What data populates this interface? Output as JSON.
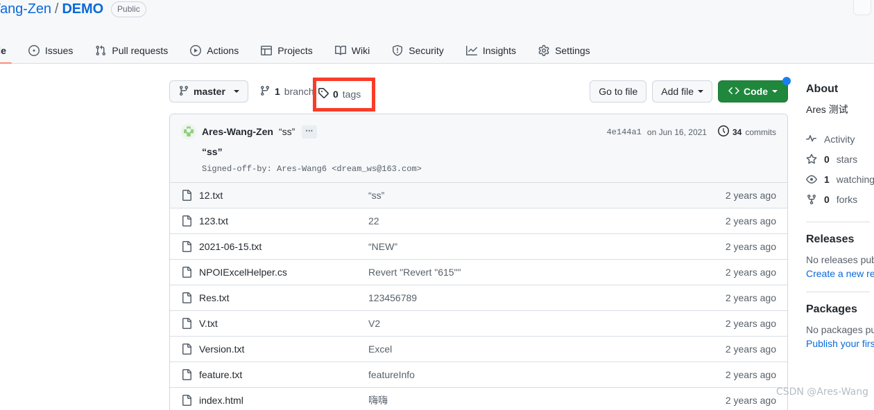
{
  "header": {
    "owner": "res-Wang-Zen",
    "separator": "/",
    "repo": "DEMO",
    "visibility": "Public",
    "nav": [
      {
        "label": "ode",
        "icon": "code-icon",
        "name": "tab-code",
        "selected": true
      },
      {
        "label": "Issues",
        "icon": "issue-opened-icon",
        "name": "tab-issues",
        "selected": false
      },
      {
        "label": "Pull requests",
        "icon": "git-pull-request-icon",
        "name": "tab-pull-requests",
        "selected": false
      },
      {
        "label": "Actions",
        "icon": "play-icon",
        "name": "tab-actions",
        "selected": false
      },
      {
        "label": "Projects",
        "icon": "table-icon",
        "name": "tab-projects",
        "selected": false
      },
      {
        "label": "Wiki",
        "icon": "book-icon",
        "name": "tab-wiki",
        "selected": false
      },
      {
        "label": "Security",
        "icon": "shield-icon",
        "name": "tab-security",
        "selected": false
      },
      {
        "label": "Insights",
        "icon": "graph-icon",
        "name": "tab-insights",
        "selected": false
      },
      {
        "label": "Settings",
        "icon": "gear-icon",
        "name": "tab-settings",
        "selected": false
      }
    ]
  },
  "branch_bar": {
    "branch_button_label": "master",
    "branches_count": "1",
    "branches_label": "branch",
    "tags_count": "0",
    "tags_label": "tags",
    "go_to_file": "Go to file",
    "add_file": "Add file",
    "code": "Code"
  },
  "highlight": {
    "color": "#fa3c28",
    "target": "0 tags"
  },
  "commit": {
    "author": "Ares-Wang-Zen",
    "title_inline": "“ss”",
    "ellipsis": "…",
    "message": "“ss”",
    "signoff": "Signed-off-by: Ares-Wang6 <dream_ws@163.com>",
    "sha": "4e144a1",
    "date": "on Jun 16, 2021",
    "commits_count": "34",
    "commits_label": "commits"
  },
  "files": [
    {
      "name": "12.txt",
      "message": "“ss”",
      "time": "2 years ago",
      "highlight": true
    },
    {
      "name": "123.txt",
      "message": "22",
      "time": "2 years ago",
      "highlight": false
    },
    {
      "name": "2021-06-15.txt",
      "message": "“NEW”",
      "time": "2 years ago",
      "highlight": false
    },
    {
      "name": "NPOIExcelHelper.cs",
      "message": "Revert \"Revert \"615\"\"",
      "time": "2 years ago",
      "highlight": false
    },
    {
      "name": "Res.txt",
      "message": "123456789",
      "time": "2 years ago",
      "highlight": false
    },
    {
      "name": "V.txt",
      "message": "V2",
      "time": "2 years ago",
      "highlight": false
    },
    {
      "name": "Version.txt",
      "message": "Excel",
      "time": "2 years ago",
      "highlight": false
    },
    {
      "name": "feature.txt",
      "message": "featureInfo",
      "time": "2 years ago",
      "highlight": false
    },
    {
      "name": "index.html",
      "message": "嗨嗨",
      "time": "2 years ago",
      "highlight": false
    }
  ],
  "sidebar": {
    "about_heading": "About",
    "description": "Ares 测试",
    "stats": [
      {
        "icon": "pulse-icon",
        "label": "Activity",
        "count": ""
      },
      {
        "icon": "star-icon",
        "label": "stars",
        "count": "0"
      },
      {
        "icon": "eye-icon",
        "label": "watching",
        "count": "1"
      },
      {
        "icon": "fork-icon",
        "label": "forks",
        "count": "0"
      }
    ],
    "releases_heading": "Releases",
    "releases_note": "No releases publish",
    "releases_link": "Create a new relea",
    "packages_heading": "Packages",
    "packages_note": "No packages publi",
    "packages_link": "Publish your first p"
  },
  "watermark": "CSDN @Ares-Wang"
}
